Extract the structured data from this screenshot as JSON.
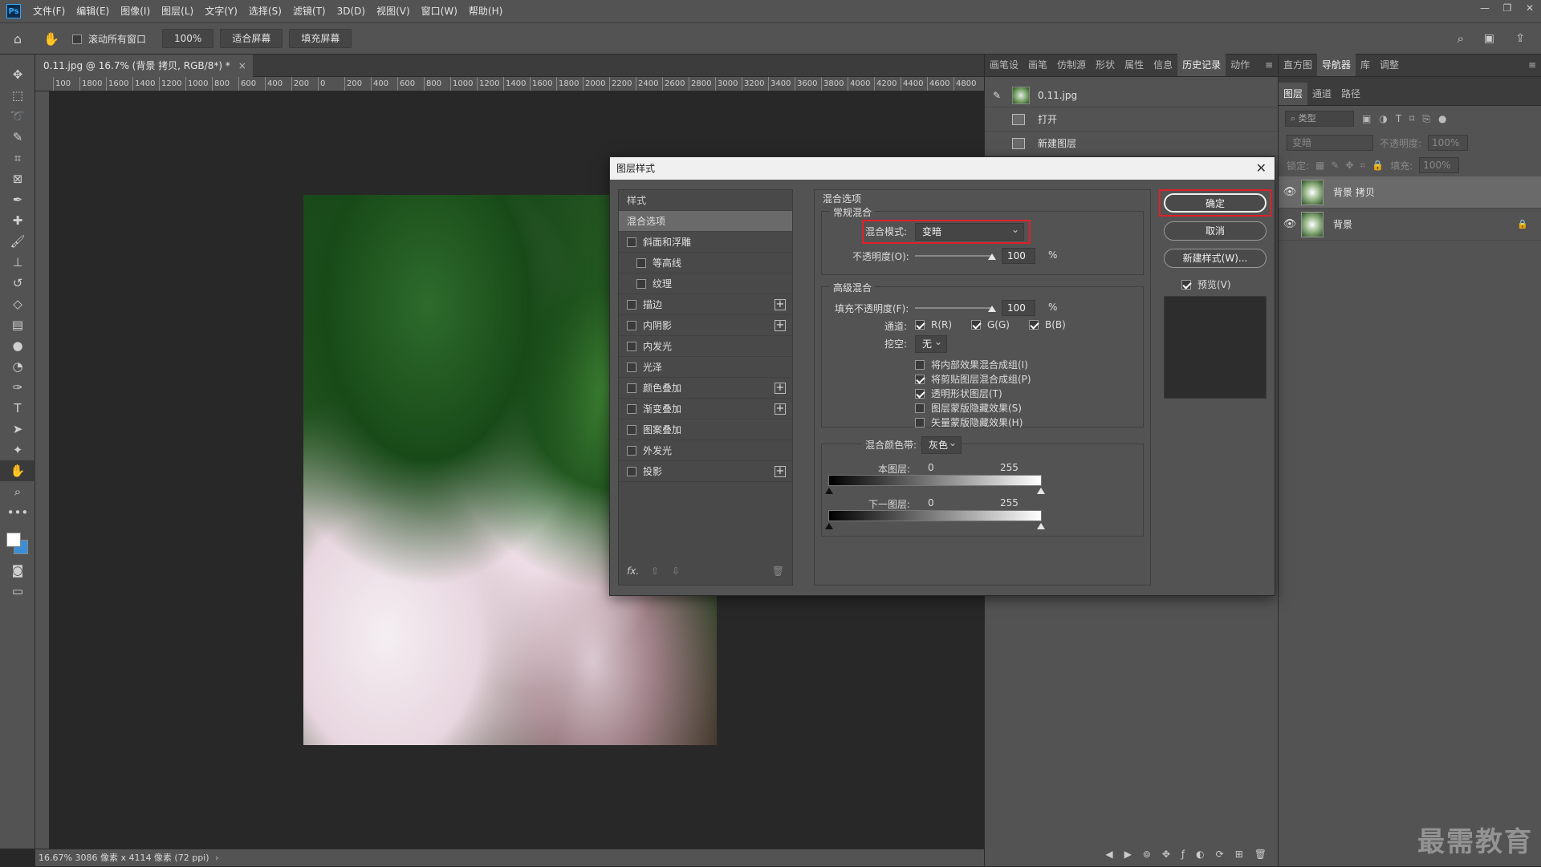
{
  "app": {
    "logo": "Ps"
  },
  "menu": [
    "文件(F)",
    "编辑(E)",
    "图像(I)",
    "图层(L)",
    "文字(Y)",
    "选择(S)",
    "滤镜(T)",
    "3D(D)",
    "视图(V)",
    "窗口(W)",
    "帮助(H)"
  ],
  "window_controls": [
    "—",
    "❐",
    "✕"
  ],
  "options_bar": {
    "scroll_all_label": "滚动所有窗口",
    "zoom": "100%",
    "fit_screen": "适合屏幕",
    "fill_screen": "填充屏幕"
  },
  "document": {
    "tab_title": "0.11.jpg @ 16.7% (背景 拷贝, RGB/8*) *",
    "tab_close": "×",
    "ruler_ticks": [
      "100",
      "1800",
      "1600",
      "1400",
      "1200",
      "1000",
      "800",
      "600",
      "400",
      "200",
      "0",
      "200",
      "400",
      "600",
      "800",
      "1000",
      "1200",
      "1400",
      "1600",
      "1800",
      "2000",
      "2200",
      "2400",
      "2600",
      "2800",
      "3000",
      "3200",
      "3400",
      "3600",
      "3800",
      "4000",
      "4200",
      "4400",
      "4600",
      "4800"
    ],
    "status_zoom": "16.67%",
    "status_info": "3086 像素 x 4114 像素 (72 ppi)"
  },
  "history_panel": {
    "tabs": [
      "画笔设",
      "画笔",
      "仿制源",
      "形状",
      "属性",
      "信息",
      "历史记录",
      "动作"
    ],
    "active_tab": "历史记录",
    "snapshot": "0.11.jpg",
    "items": [
      "打开",
      "新建图层"
    ]
  },
  "layers_panel": {
    "top_tabs": [
      "直方图",
      "导航器",
      "库",
      "调整"
    ],
    "tabs": [
      "图层",
      "通道",
      "路径"
    ],
    "filter_placeholder": "类型",
    "blend_mode": "变暗",
    "opacity_label": "不透明度:",
    "opacity_value": "100%",
    "lock_label": "锁定:",
    "fill_label": "填充:",
    "fill_value": "100%",
    "layers": [
      {
        "name": "背景 拷贝",
        "selected": true
      },
      {
        "name": "背景",
        "selected": false
      }
    ]
  },
  "dialog": {
    "title": "图层样式",
    "styles": [
      {
        "label": "样式",
        "type": "header"
      },
      {
        "label": "混合选项",
        "type": "selected"
      },
      {
        "label": "斜面和浮雕",
        "check": true,
        "plus": false
      },
      {
        "label": "等高线",
        "check": true,
        "plus": false,
        "indent": true
      },
      {
        "label": "纹理",
        "check": true,
        "plus": false,
        "indent": true
      },
      {
        "label": "描边",
        "check": true,
        "plus": true
      },
      {
        "label": "内阴影",
        "check": true,
        "plus": true
      },
      {
        "label": "内发光",
        "check": true,
        "plus": false
      },
      {
        "label": "光泽",
        "check": true,
        "plus": false
      },
      {
        "label": "颜色叠加",
        "check": true,
        "plus": true
      },
      {
        "label": "渐变叠加",
        "check": true,
        "plus": true
      },
      {
        "label": "图案叠加",
        "check": true,
        "plus": false
      },
      {
        "label": "外发光",
        "check": true,
        "plus": false
      },
      {
        "label": "投影",
        "check": true,
        "plus": true
      }
    ],
    "fx_label": "fx.",
    "blend_options": {
      "section": "混合选项",
      "general": "常规混合",
      "blend_mode_label": "混合模式:",
      "blend_mode": "变暗",
      "opacity_label": "不透明度(O):",
      "opacity": "100",
      "pct": "%",
      "advanced": "高级混合",
      "fill_opacity_label": "填充不透明度(F):",
      "fill_opacity": "100",
      "channels_label": "通道:",
      "ch_r": "R(R)",
      "ch_g": "G(G)",
      "ch_b": "B(B)",
      "knockout_label": "挖空:",
      "knockout": "无",
      "opt1": "将内部效果混合成组(I)",
      "opt2": "将剪贴图层混合成组(P)",
      "opt3": "透明形状图层(T)",
      "opt4": "图层蒙版隐藏效果(S)",
      "opt5": "矢量蒙版隐藏效果(H)",
      "blend_if_label": "混合颜色带:",
      "blend_if": "灰色",
      "this_layer_label": "本图层:",
      "this_layer_min": "0",
      "this_layer_max": "255",
      "under_layer_label": "下一图层:",
      "under_layer_min": "0",
      "under_layer_max": "255"
    },
    "ok": "确定",
    "cancel": "取消",
    "new_style": "新建样式(W)...",
    "preview_label": "预览(V)"
  },
  "watermark": "最需教育",
  "accent_colors": {
    "highlight_box": "#e0202a",
    "ps_blue": "#31a8ff"
  }
}
